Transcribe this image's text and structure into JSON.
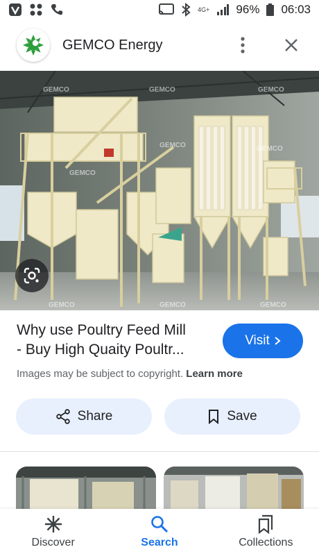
{
  "status_bar": {
    "battery": "96%",
    "time": "06:03",
    "network": "4G+"
  },
  "header": {
    "site_name": "GEMCO Energy"
  },
  "image": {
    "watermark": "GEMCO"
  },
  "result": {
    "caption_line1": "Why use Poultry Feed Mill",
    "caption_line2": "- Buy High Quaity Poultr...",
    "visit_label": "Visit",
    "copyright_text": "Images may be subject to copyright.",
    "learn_more": "Learn more"
  },
  "actions": {
    "share_label": "Share",
    "save_label": "Save"
  },
  "bottom_nav": {
    "items": [
      {
        "label": "Discover",
        "icon": "asterisk-icon"
      },
      {
        "label": "Search",
        "icon": "search-icon"
      },
      {
        "label": "Collections",
        "icon": "collections-icon"
      }
    ],
    "active": "Search"
  },
  "colors": {
    "accent": "#1a73e8",
    "chip_bg": "#e8f0fe",
    "logo_green": "#2e9e3c"
  }
}
